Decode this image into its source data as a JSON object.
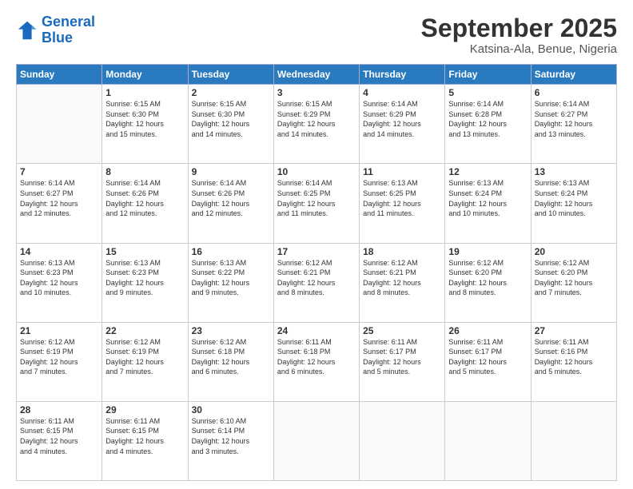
{
  "logo": {
    "line1": "General",
    "line2": "Blue"
  },
  "title": "September 2025",
  "subtitle": "Katsina-Ala, Benue, Nigeria",
  "days_header": [
    "Sunday",
    "Monday",
    "Tuesday",
    "Wednesday",
    "Thursday",
    "Friday",
    "Saturday"
  ],
  "weeks": [
    [
      {
        "num": "",
        "info": ""
      },
      {
        "num": "1",
        "info": "Sunrise: 6:15 AM\nSunset: 6:30 PM\nDaylight: 12 hours\nand 15 minutes."
      },
      {
        "num": "2",
        "info": "Sunrise: 6:15 AM\nSunset: 6:30 PM\nDaylight: 12 hours\nand 14 minutes."
      },
      {
        "num": "3",
        "info": "Sunrise: 6:15 AM\nSunset: 6:29 PM\nDaylight: 12 hours\nand 14 minutes."
      },
      {
        "num": "4",
        "info": "Sunrise: 6:14 AM\nSunset: 6:29 PM\nDaylight: 12 hours\nand 14 minutes."
      },
      {
        "num": "5",
        "info": "Sunrise: 6:14 AM\nSunset: 6:28 PM\nDaylight: 12 hours\nand 13 minutes."
      },
      {
        "num": "6",
        "info": "Sunrise: 6:14 AM\nSunset: 6:27 PM\nDaylight: 12 hours\nand 13 minutes."
      }
    ],
    [
      {
        "num": "7",
        "info": "Sunrise: 6:14 AM\nSunset: 6:27 PM\nDaylight: 12 hours\nand 12 minutes."
      },
      {
        "num": "8",
        "info": "Sunrise: 6:14 AM\nSunset: 6:26 PM\nDaylight: 12 hours\nand 12 minutes."
      },
      {
        "num": "9",
        "info": "Sunrise: 6:14 AM\nSunset: 6:26 PM\nDaylight: 12 hours\nand 12 minutes."
      },
      {
        "num": "10",
        "info": "Sunrise: 6:14 AM\nSunset: 6:25 PM\nDaylight: 12 hours\nand 11 minutes."
      },
      {
        "num": "11",
        "info": "Sunrise: 6:13 AM\nSunset: 6:25 PM\nDaylight: 12 hours\nand 11 minutes."
      },
      {
        "num": "12",
        "info": "Sunrise: 6:13 AM\nSunset: 6:24 PM\nDaylight: 12 hours\nand 10 minutes."
      },
      {
        "num": "13",
        "info": "Sunrise: 6:13 AM\nSunset: 6:24 PM\nDaylight: 12 hours\nand 10 minutes."
      }
    ],
    [
      {
        "num": "14",
        "info": "Sunrise: 6:13 AM\nSunset: 6:23 PM\nDaylight: 12 hours\nand 10 minutes."
      },
      {
        "num": "15",
        "info": "Sunrise: 6:13 AM\nSunset: 6:23 PM\nDaylight: 12 hours\nand 9 minutes."
      },
      {
        "num": "16",
        "info": "Sunrise: 6:13 AM\nSunset: 6:22 PM\nDaylight: 12 hours\nand 9 minutes."
      },
      {
        "num": "17",
        "info": "Sunrise: 6:12 AM\nSunset: 6:21 PM\nDaylight: 12 hours\nand 8 minutes."
      },
      {
        "num": "18",
        "info": "Sunrise: 6:12 AM\nSunset: 6:21 PM\nDaylight: 12 hours\nand 8 minutes."
      },
      {
        "num": "19",
        "info": "Sunrise: 6:12 AM\nSunset: 6:20 PM\nDaylight: 12 hours\nand 8 minutes."
      },
      {
        "num": "20",
        "info": "Sunrise: 6:12 AM\nSunset: 6:20 PM\nDaylight: 12 hours\nand 7 minutes."
      }
    ],
    [
      {
        "num": "21",
        "info": "Sunrise: 6:12 AM\nSunset: 6:19 PM\nDaylight: 12 hours\nand 7 minutes."
      },
      {
        "num": "22",
        "info": "Sunrise: 6:12 AM\nSunset: 6:19 PM\nDaylight: 12 hours\nand 7 minutes."
      },
      {
        "num": "23",
        "info": "Sunrise: 6:12 AM\nSunset: 6:18 PM\nDaylight: 12 hours\nand 6 minutes."
      },
      {
        "num": "24",
        "info": "Sunrise: 6:11 AM\nSunset: 6:18 PM\nDaylight: 12 hours\nand 6 minutes."
      },
      {
        "num": "25",
        "info": "Sunrise: 6:11 AM\nSunset: 6:17 PM\nDaylight: 12 hours\nand 5 minutes."
      },
      {
        "num": "26",
        "info": "Sunrise: 6:11 AM\nSunset: 6:17 PM\nDaylight: 12 hours\nand 5 minutes."
      },
      {
        "num": "27",
        "info": "Sunrise: 6:11 AM\nSunset: 6:16 PM\nDaylight: 12 hours\nand 5 minutes."
      }
    ],
    [
      {
        "num": "28",
        "info": "Sunrise: 6:11 AM\nSunset: 6:15 PM\nDaylight: 12 hours\nand 4 minutes."
      },
      {
        "num": "29",
        "info": "Sunrise: 6:11 AM\nSunset: 6:15 PM\nDaylight: 12 hours\nand 4 minutes."
      },
      {
        "num": "30",
        "info": "Sunrise: 6:10 AM\nSunset: 6:14 PM\nDaylight: 12 hours\nand 3 minutes."
      },
      {
        "num": "",
        "info": ""
      },
      {
        "num": "",
        "info": ""
      },
      {
        "num": "",
        "info": ""
      },
      {
        "num": "",
        "info": ""
      }
    ]
  ]
}
